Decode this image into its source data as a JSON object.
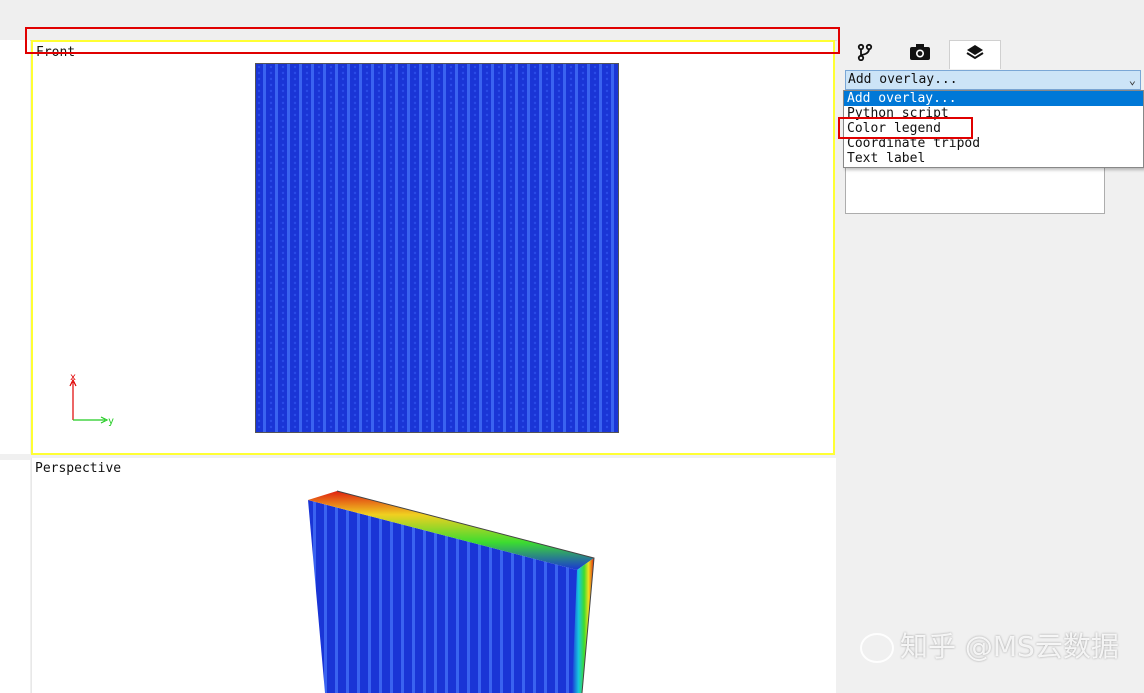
{
  "viewports": {
    "front": {
      "caption": "Front",
      "tripod": {
        "x_label": "y",
        "y_label": "x"
      }
    },
    "perspective": {
      "caption": "Perspective"
    }
  },
  "panel": {
    "tabs": [
      {
        "icon": "pipeline-icon",
        "active": false
      },
      {
        "icon": "camera-icon",
        "active": false
      },
      {
        "icon": "layers-icon",
        "active": true
      }
    ],
    "overlay_combo": {
      "value": "Add overlay..."
    },
    "overlay_options": [
      "Add overlay...",
      "Python script",
      "Color legend",
      "Coordinate tripod",
      "Text label"
    ],
    "selected_option": "Add overlay..."
  },
  "watermark": {
    "text": "知乎 @MS云数据"
  },
  "colors": {
    "model_blue": "#1a35d6",
    "model_blue_light": "#3a63f0",
    "viewport_highlight": "#ffff33",
    "annotation_red": "#e00000",
    "selection": "#0078d7"
  }
}
